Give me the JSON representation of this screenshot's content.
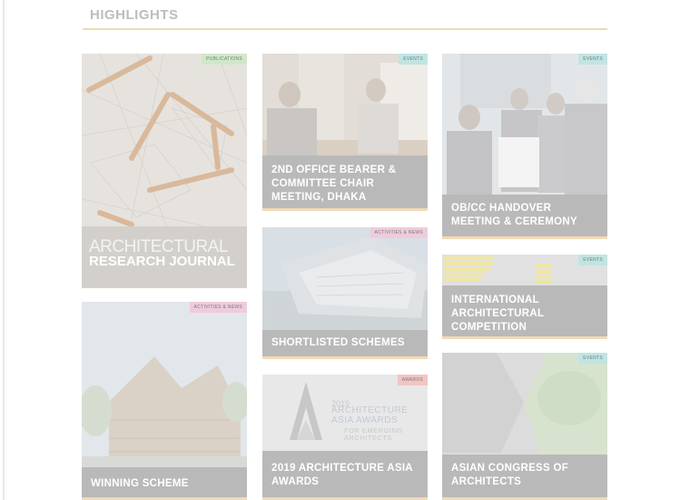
{
  "section": {
    "title": "HIGHLIGHTS"
  },
  "cards": [
    {
      "tag": "PUBLICATIONS",
      "journal_line1": "ARCHITECTURAL",
      "journal_line2": "RESEARCH JOURNAL"
    },
    {
      "tag": "EVENTS",
      "label": "2ND OFFICE BEARER & COMMITTEE CHAIR MEETING, DHAKA"
    },
    {
      "tag": "EVENTS",
      "label": "OB/CC HANDOVER MEETING & CEREMONY"
    },
    {
      "tag": "ACTIVITIES & NEWS",
      "label": "SHORTLISTED SCHEMES"
    },
    {
      "tag": "EVENTS",
      "label": "INTERNATIONAL ARCHITECTURAL COMPETITION"
    },
    {
      "tag": "ACTIVITIES & NEWS",
      "label": "WINNING SCHEME"
    },
    {
      "tag": "AWARDS",
      "label": "2019 ARCHITECTURE ASIA AWARDS",
      "logo_letter": "A",
      "logo_year": "2019",
      "logo_line1": "ARCHITECTURE",
      "logo_line2": "ASIA AWARDS",
      "logo_line3": "FOR EMERGING",
      "logo_line4": "ARCHITECTS"
    },
    {
      "tag": "EVENTS",
      "label": "ASIAN CONGRESS OF ARCHITECTS"
    }
  ]
}
